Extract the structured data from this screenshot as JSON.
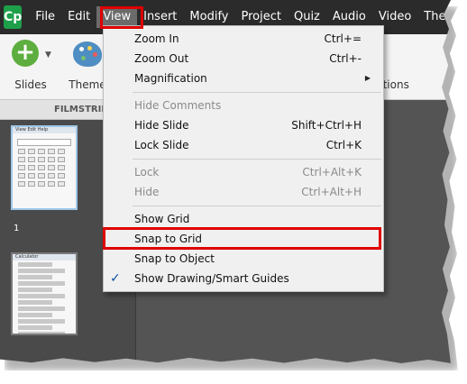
{
  "app": {
    "logo_text": "Cp",
    "brand_color": "#1e9f4a"
  },
  "menubar": {
    "items": [
      "File",
      "Edit",
      "View",
      "Insert",
      "Modify",
      "Project",
      "Quiz",
      "Audio",
      "Video",
      "Them"
    ],
    "active": "View",
    "highlight_color": "#e00000"
  },
  "toolbar": {
    "slides_label": "Slides",
    "themes_label": "Theme",
    "interactions_label": "ctions"
  },
  "filmstrip": {
    "header": "FILMSTRIP",
    "slide_numbers": [
      "1"
    ],
    "thumb1_menu": "View  Edit  Help",
    "thumb2_menu": "Calculator"
  },
  "view_menu": {
    "items": [
      {
        "label": "Zoom In",
        "shortcut": "Ctrl+=",
        "enabled": true
      },
      {
        "label": "Zoom Out",
        "shortcut": "Ctrl+-",
        "enabled": true
      },
      {
        "label": "Magnification",
        "shortcut": "",
        "enabled": true,
        "submenu": true
      },
      {
        "label": "Hide Comments",
        "shortcut": "",
        "enabled": false
      },
      {
        "label": "Hide Slide",
        "shortcut": "Shift+Ctrl+H",
        "enabled": true
      },
      {
        "label": "Lock Slide",
        "shortcut": "Ctrl+K",
        "enabled": true
      },
      {
        "label": "Lock",
        "shortcut": "Ctrl+Alt+K",
        "enabled": false
      },
      {
        "label": "Hide",
        "shortcut": "Ctrl+Alt+H",
        "enabled": false
      },
      {
        "label": "Show Grid",
        "shortcut": "",
        "enabled": true
      },
      {
        "label": "Snap to Grid",
        "shortcut": "",
        "enabled": true,
        "highlighted": true
      },
      {
        "label": "Snap to Object",
        "shortcut": "",
        "enabled": true
      },
      {
        "label": "Show Drawing/Smart Guides",
        "shortcut": "",
        "enabled": true,
        "checked": true
      }
    ],
    "submenu_arrow": "▶",
    "check_mark": "✓"
  }
}
